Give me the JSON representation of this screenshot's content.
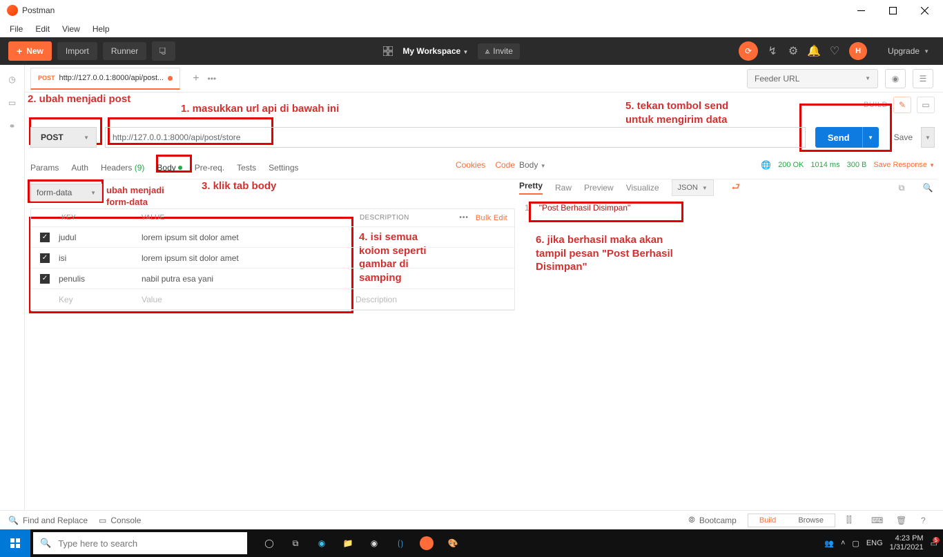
{
  "window": {
    "title": "Postman"
  },
  "menu": {
    "file": "File",
    "edit": "Edit",
    "view": "View",
    "help": "Help"
  },
  "toolbar": {
    "new": "New",
    "import": "Import",
    "runner": "Runner",
    "workspace": "My Workspace",
    "invite": "Invite",
    "upgrade": "Upgrade",
    "user_initial": "H"
  },
  "tab": {
    "method": "POST",
    "title": "http://127.0.0.1:8000/api/post..."
  },
  "env": {
    "label": "Feeder URL"
  },
  "build": {
    "label": "BUILD"
  },
  "request": {
    "method": "POST",
    "url": "http://127.0.0.1:8000/api/post/store",
    "send": "Send",
    "save": "Save"
  },
  "subtabs": {
    "params": "Params",
    "auth": "Auth",
    "headers": "Headers",
    "headers_count": "(9)",
    "body": "Body",
    "prereq": "Pre-req.",
    "tests": "Tests",
    "settings": "Settings",
    "cookies": "Cookies",
    "code": "Code"
  },
  "formdata": {
    "label": "form-data"
  },
  "kv": {
    "h_key": "KEY",
    "h_value": "VALUE",
    "h_desc": "DESCRIPTION",
    "bulk": "Bulk Edit",
    "rows": [
      {
        "key": "judul",
        "value": "lorem ipsum sit dolor amet"
      },
      {
        "key": "isi",
        "value": "lorem ipsum sit dolor amet"
      },
      {
        "key": "penulis",
        "value": "nabil putra esa yani"
      }
    ],
    "ph_key": "Key",
    "ph_value": "Value",
    "ph_desc": "Description"
  },
  "response": {
    "body_label": "Body",
    "status": "200 OK",
    "time": "1014 ms",
    "size": "300 B",
    "save": "Save Response",
    "tabs": {
      "pretty": "Pretty",
      "raw": "Raw",
      "preview": "Preview",
      "visualize": "Visualize"
    },
    "format": "JSON",
    "line_no": "1",
    "text": "\"Post Berhasil Disimpan\""
  },
  "annotations": {
    "a1": "1. masukkan url api di bawah ini",
    "a2": "2. ubah menjadi post",
    "a3": "3. klik tab body",
    "a4_l1": "ubah menjadi",
    "a4_l2": "form-data",
    "a5_l1": "4. isi semua",
    "a5_l2": "kolom seperti",
    "a5_l3": "gambar di",
    "a5_l4": "samping",
    "a6_l1": "5. tekan tombol send",
    "a6_l2": "untuk mengirim data",
    "a7_l1": "6. jika berhasil maka akan",
    "a7_l2": "tampil pesan \"Post Berhasil",
    "a7_l3": "Disimpan\""
  },
  "footer": {
    "find": "Find and Replace",
    "console": "Console",
    "bootcamp": "Bootcamp",
    "build": "Build",
    "browse": "Browse"
  },
  "taskbar": {
    "search": "Type here to search",
    "lang": "ENG",
    "time": "4:23 PM",
    "date": "1/31/2021",
    "notif_count": "5"
  }
}
